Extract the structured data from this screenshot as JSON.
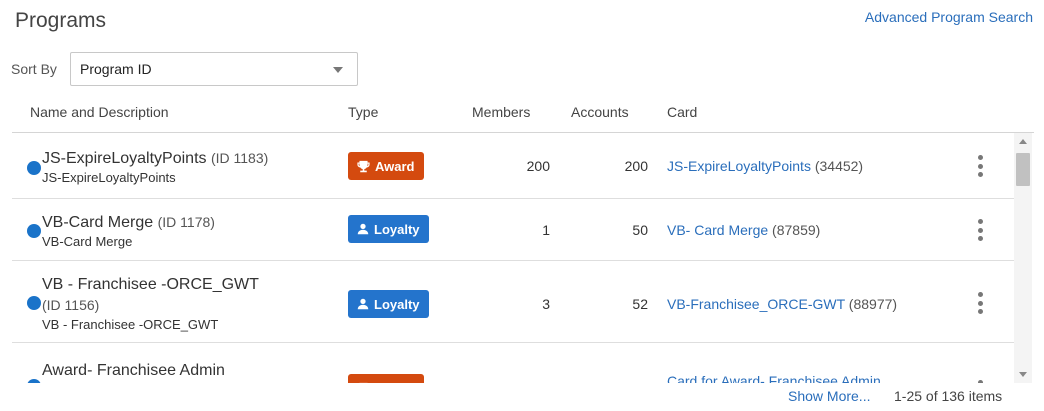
{
  "page": {
    "title": "Programs",
    "advanced_search_link": "Advanced Program Search"
  },
  "sort": {
    "label": "Sort By",
    "value": "Program ID"
  },
  "table": {
    "columns": {
      "name": "Name and Description",
      "type": "Type",
      "members": "Members",
      "accounts": "Accounts",
      "card": "Card"
    },
    "rows": [
      {
        "name": "JS-ExpireLoyaltyPoints",
        "id": "(ID 1183)",
        "description": "JS-ExpireLoyaltyPoints",
        "type": "Award",
        "type_icon": "trophy-icon",
        "members": "200",
        "accounts": "200",
        "card_name": "JS-ExpireLoyaltyPoints",
        "card_id": "(34452)"
      },
      {
        "name": "VB-Card Merge",
        "id": "(ID 1178)",
        "description": "VB-Card Merge",
        "type": "Loyalty",
        "type_icon": "person-icon",
        "members": "1",
        "accounts": "50",
        "card_name": "VB- Card Merge",
        "card_id": "(87859)"
      },
      {
        "name": "VB - Franchisee -ORCE_GWT",
        "id": "(ID 1156)",
        "description": "VB - Franchisee -ORCE_GWT",
        "type": "Loyalty",
        "type_icon": "person-icon",
        "members": "3",
        "accounts": "52",
        "card_name": "VB-Franchisee_ORCE-GWT",
        "card_id": "(88977)"
      },
      {
        "name": "Award- Franchisee Admin",
        "type": "Award",
        "type_icon": "trophy-icon",
        "card_name": "Card for Award- Franchisee Admin"
      }
    ]
  },
  "footer": {
    "show_more": "Show More...",
    "count": "1-25 of 136 items"
  },
  "colors": {
    "link": "#2a6ebb",
    "award_badge": "#d44a0f",
    "loyalty_badge": "#2474cc",
    "status_dot": "#1a73c9"
  }
}
